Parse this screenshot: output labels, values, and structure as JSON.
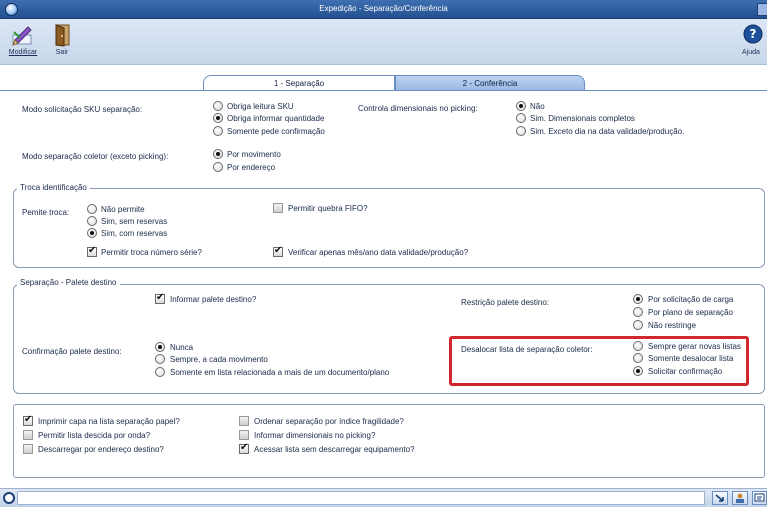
{
  "window": {
    "title": "Expedição - Separação/Conferência"
  },
  "toolbar": {
    "modify_label": "Modificar",
    "exit_label": "Sair",
    "help_label": "Ajuda"
  },
  "tabs": [
    {
      "label": "1 - Separação"
    },
    {
      "label": "2 - Conferência"
    }
  ],
  "sku_mode": {
    "label": "Modo solicitação SKU separação:",
    "options": [
      "Obriga leitura SKU",
      "Obriga informar quantidade",
      "Somente pede confirmação"
    ],
    "selected": 1
  },
  "dimensional_control": {
    "label": "Controla dimensionais no picking:",
    "options": [
      "Não",
      "Sim. Dimensionais completos",
      "Sim. Exceto dia na data validade/produção."
    ],
    "selected": 0
  },
  "collector_mode": {
    "label": "Modo separação coletor (exceto picking):",
    "options": [
      "Por movimento",
      "Por endereço"
    ],
    "selected": 0
  },
  "id_exchange": {
    "title": "Troca identificação",
    "allow_label": "Pemite troca:",
    "options": [
      "Não permite",
      "Sim, sem reservas",
      "Sim, com reservas"
    ],
    "selected": 2,
    "fifo_break_label": "Permitir quebra FIFO?",
    "fifo_break_checked": false,
    "serial_swap_label": "Permitir troca número série?",
    "serial_swap_checked": true,
    "month_year_label": "Verificar apenas mês/ano data validade/produção?",
    "month_year_checked": true
  },
  "pallet_dest": {
    "title": "Separação - Palete destino",
    "inform_label": "Informar palete destino?",
    "inform_checked": true,
    "restriction_label": "Restrição palete destino:",
    "restriction_options": [
      "Por solicitação de carga",
      "Por plano de separação",
      "Não restringe"
    ],
    "restriction_selected": 0,
    "confirm_label": "Confirmação palete destino:",
    "confirm_options": [
      "Nunca",
      "Sempre, a cada movimento",
      "Somente em lista relacionada a mais de um documento/plano"
    ],
    "confirm_selected": 0,
    "dealloc_label": "Desalocar lista de separação coletor:",
    "dealloc_options": [
      "Sempre gerar novas listas",
      "Somente desalocar lista",
      "Solicitar confirmação"
    ],
    "dealloc_selected": 2
  },
  "options": {
    "print_cover_label": "Imprimir capa na lista separação papel?",
    "print_cover_checked": true,
    "allow_descent_label": "Permitir lista descida por onda?",
    "allow_descent_checked": false,
    "unload_by_address_label": "Descarregar por endereço destino?",
    "unload_by_address_checked": false,
    "order_fragility_label": "Ordenar separação por índice fragilidade?",
    "order_fragility_checked": false,
    "inform_dimensional_label": "Informar dimensionais no picking?",
    "inform_dimensional_checked": false,
    "access_without_unload_label": "Acessar lista sem descarregar equipamento?",
    "access_without_unload_checked": true
  },
  "colors": {
    "title_bar": "#2e5c9e",
    "highlight": "#d0262c",
    "toolbar": "#d3e0f1"
  }
}
